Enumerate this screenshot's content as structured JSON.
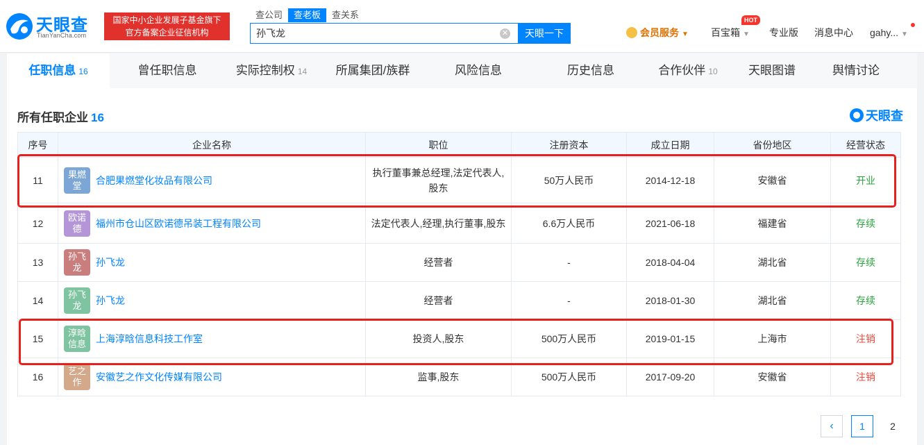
{
  "header": {
    "logo_text": "天眼查",
    "logo_sub": "TianYanCha.com",
    "banner_line1": "国家中小企业发展子基金旗下",
    "banner_line2": "官方备案企业征信机构",
    "search_tabs": [
      "查公司",
      "查老板",
      "查关系"
    ],
    "active_search_tab": 1,
    "search_value": "孙飞龙",
    "search_button": "天眼一下",
    "vip": "会员服务",
    "box": "百宝箱",
    "hot_badge": "HOT",
    "pro": "专业版",
    "messages": "消息中心",
    "user": "gahy..."
  },
  "tabs": [
    {
      "label": "任职信息",
      "count": "16"
    },
    {
      "label": "曾任职信息",
      "count": ""
    },
    {
      "label": "实际控制权",
      "count": "14"
    },
    {
      "label": "所属集团/族群",
      "count": ""
    },
    {
      "label": "风险信息",
      "count": ""
    },
    {
      "label": "历史信息",
      "count": ""
    },
    {
      "label": "合作伙伴",
      "count": "10"
    },
    {
      "label": "天眼图谱",
      "count": ""
    },
    {
      "label": "舆情讨论",
      "count": ""
    }
  ],
  "section": {
    "title": "所有任职企业",
    "count": "16",
    "watermark": "天眼查"
  },
  "table": {
    "headers": [
      "序号",
      "企业名称",
      "职位",
      "注册资本",
      "成立日期",
      "省份地区",
      "经营状态"
    ],
    "rows": [
      {
        "idx": "11",
        "avatar": "果燃堂",
        "avatar_color": "#7ba6d6",
        "name": "合肥果燃堂化妆品有限公司",
        "position": "执行董事兼总经理,法定代表人,股东",
        "capital": "50万人民币",
        "date": "2014-12-18",
        "province": "安徽省",
        "status": "开业",
        "status_color": "green"
      },
      {
        "idx": "12",
        "avatar": "欧诺德",
        "avatar_color": "#b496d8",
        "name": "福州市仓山区欧诺德吊装工程有限公司",
        "position": "法定代表人,经理,执行董事,股东",
        "capital": "6.6万人民币",
        "date": "2021-06-18",
        "province": "福建省",
        "status": "存续",
        "status_color": "green"
      },
      {
        "idx": "13",
        "avatar": "孙飞龙",
        "avatar_color": "#c97d7d",
        "name": "孙飞龙",
        "position": "经营者",
        "capital": "-",
        "date": "2018-04-04",
        "province": "湖北省",
        "status": "存续",
        "status_color": "green"
      },
      {
        "idx": "14",
        "avatar": "孙飞龙",
        "avatar_color": "#7fc4a0",
        "name": "孙飞龙",
        "position": "经营者",
        "capital": "-",
        "date": "2018-01-30",
        "province": "湖北省",
        "status": "存续",
        "status_color": "green"
      },
      {
        "idx": "15",
        "avatar": "淳晗信息",
        "avatar_color": "#7fc4a0",
        "name": "上海淳晗信息科技工作室",
        "position": "投资人,股东",
        "capital": "500万人民币",
        "date": "2019-01-15",
        "province": "上海市",
        "status": "注销",
        "status_color": "red"
      },
      {
        "idx": "16",
        "avatar": "艺之作",
        "avatar_color": "#d4a88a",
        "name": "安徽艺之作文化传媒有限公司",
        "position": "监事,股东",
        "capital": "500万人民币",
        "date": "2017-09-20",
        "province": "安徽省",
        "status": "注销",
        "status_color": "red"
      }
    ]
  },
  "pager": {
    "prev": "‹",
    "pages": [
      "1",
      "2"
    ]
  }
}
